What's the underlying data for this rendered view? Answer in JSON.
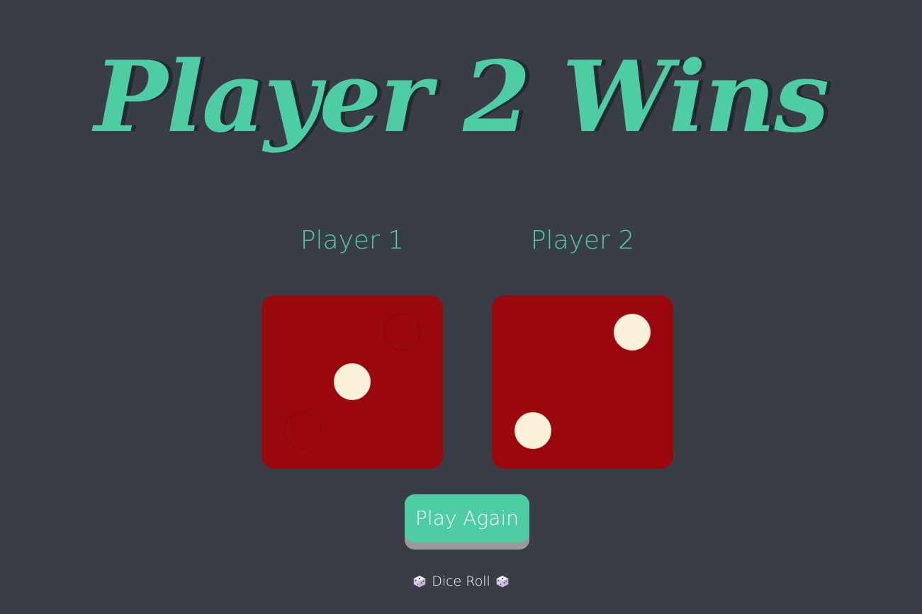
{
  "game": {
    "title": "Player 2 Wins",
    "players": [
      {
        "label": "Player 1",
        "die_value": 1
      },
      {
        "label": "Player 2",
        "die_value": 2
      }
    ],
    "play_again_label": "Play Again",
    "footer_text": "Dice Roll",
    "colors": {
      "background": "#393e46",
      "accent": "#4ecca3",
      "title_shadow": "#232931",
      "die": "#9a070c",
      "pip": "#fbf0da",
      "button_shadow": "#9a9a9a"
    },
    "icons": [
      "game-die-icon",
      "game-die-icon"
    ]
  }
}
